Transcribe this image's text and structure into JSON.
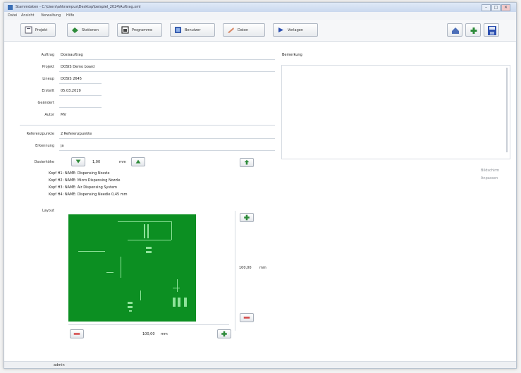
{
  "window": {
    "title": "Stammdaten - C:\\Users\\ahkrampus\\Desktop\\beispiel_2024\\Auftrag.xml",
    "controls": [
      "–",
      "□",
      "✕"
    ]
  },
  "menu": [
    "Datei",
    "Ansicht",
    "Verwaltung",
    "Hilfe"
  ],
  "toolbar": {
    "buttons": [
      {
        "label": "Projekt",
        "icon": "project-icon"
      },
      {
        "label": "Stationen",
        "icon": "stations-icon"
      },
      {
        "label": "Programme",
        "icon": "programs-icon"
      },
      {
        "label": "Benutzer",
        "icon": "users-icon"
      },
      {
        "label": "Daten",
        "icon": "data-icon"
      },
      {
        "label": "Vorlagen",
        "icon": "templates-icon"
      }
    ],
    "right_icons": [
      "home-icon",
      "add-icon",
      "save-icon"
    ]
  },
  "colors": {
    "accent": "#2e8b3a",
    "pcb": "#0c8f22",
    "remove": "#d44a4a"
  },
  "form": {
    "fields": [
      {
        "label": "Auftrag",
        "value": "Dosisauftrag"
      },
      {
        "label": "Projekt",
        "value": "DOSIS Demo board"
      },
      {
        "label": "Lineup",
        "value": "DOSIS 2645"
      },
      {
        "label": "Erstellt",
        "value": "05.03.2019"
      },
      {
        "label": "Geändert",
        "value": ""
      },
      {
        "label": "Autor",
        "value": "MV"
      }
    ],
    "section2": [
      {
        "label": "Referenzpunkte",
        "value": "2 Referenzpunkte"
      },
      {
        "label": "Erkennung",
        "value": "ja"
      }
    ],
    "dosier_label": "Dosierhöhe",
    "dosier_value": "1,00",
    "dosier_unit": "mm",
    "kopf_lines": [
      "Kopf H1:  NAME: Dispensing Nozzle",
      "Kopf H2:  NAME: Micro Dispensing Nozzle",
      "Kopf H3:  NAME: Air Dispensing System",
      "Kopf H4:  NAME: Dispensing Needle 0,45 mm"
    ],
    "layout_label": "Layout",
    "width_value": "100,00",
    "width_unit": "mm",
    "height_value": "100,00",
    "height_unit": "mm"
  },
  "bemerkung": {
    "label": "Bemerkung"
  },
  "side_buttons": [
    "Bildschirm",
    "Anpassen"
  ],
  "status": {
    "user": "admin"
  }
}
